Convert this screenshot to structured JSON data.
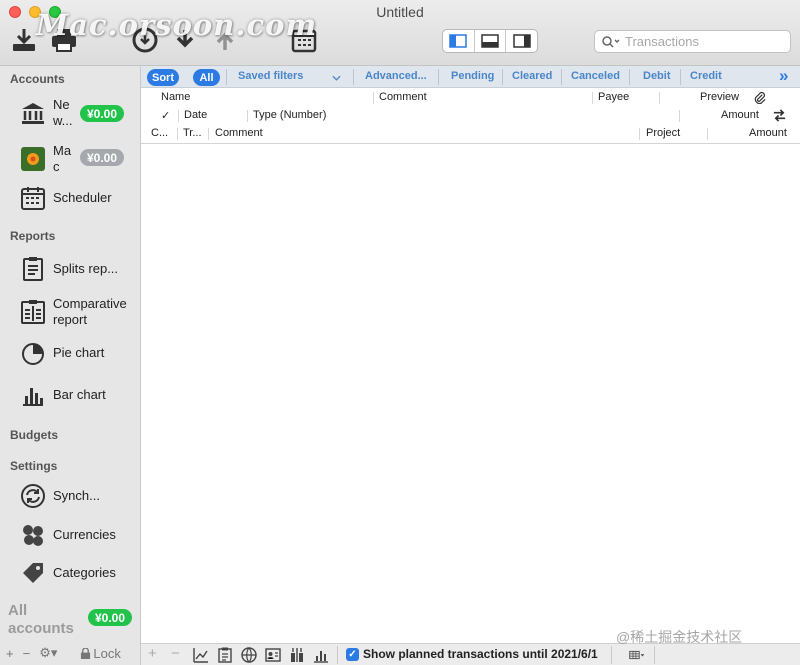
{
  "window": {
    "title": "Untitled",
    "watermark": "Mac.orsoon.com",
    "corner_watermark": "@稀土掘金技术社区"
  },
  "toolbar": {
    "icons": [
      "import-icon",
      "print-icon",
      "download-circle-icon",
      "download-icon",
      "upload-icon",
      "calendar-grid-icon"
    ],
    "view_modes": [
      "sidebar-left-view-icon",
      "bottom-panel-view-icon",
      "sidebar-right-view-icon"
    ],
    "search_placeholder": "Transactions"
  },
  "sidebar": {
    "accounts_header": "Accounts",
    "accounts": [
      {
        "label": "Ne w...",
        "icon": "bank-icon",
        "balance": "¥0.00",
        "status_color": "#22c34b"
      },
      {
        "label": "Ma c",
        "icon": "photo-icon",
        "balance": "¥0.00",
        "status_color": "#a5a9ae"
      }
    ],
    "scheduler_label": "Scheduler",
    "reports_header": "Reports",
    "reports": [
      {
        "label": "Splits rep...",
        "icon": "report-list-icon"
      },
      {
        "label": "Comparative report",
        "icon": "comparative-report-icon"
      },
      {
        "label": "Pie chart",
        "icon": "pie-chart-icon"
      },
      {
        "label": "Bar chart",
        "icon": "bar-chart-icon"
      }
    ],
    "budgets_header": "Budgets",
    "settings_header": "Settings",
    "settings": [
      {
        "label": "Synch...",
        "icon": "sync-icon"
      },
      {
        "label": "Currencies",
        "icon": "currencies-icon"
      },
      {
        "label": "Categories",
        "icon": "tag-icon"
      }
    ],
    "all_accounts_label": "All accounts",
    "all_accounts_balance": "¥0.00",
    "footer": {
      "add": "+",
      "remove": "−",
      "gear": "⚙▾",
      "lock_label": "Lock"
    }
  },
  "filterbar": {
    "sort": "Sort",
    "all": "All",
    "saved_filters": "Saved filters",
    "filters": [
      "Advanced...",
      "Pending",
      "Cleared",
      "Canceled",
      "Debit",
      "Credit"
    ],
    "more": "»"
  },
  "columns": {
    "row1": {
      "name": "Name",
      "comment": "Comment",
      "payee": "Payee",
      "preview": "Preview"
    },
    "row2": {
      "check": "✓",
      "date": "Date",
      "type": "Type (Number)",
      "amount": "Amount"
    },
    "row3": {
      "c": "C...",
      "tr": "Tr...",
      "comment": "Comment",
      "project": "Project",
      "amount": "Amount"
    }
  },
  "bottombar": {
    "add": "+",
    "remove": "−",
    "planned_label": "Show planned transactions until 2021/6/1",
    "planned_checked": true
  },
  "colors": {
    "accent": "#2c7be5",
    "link": "#4a86c8",
    "balance_positive": "#22c34b"
  }
}
